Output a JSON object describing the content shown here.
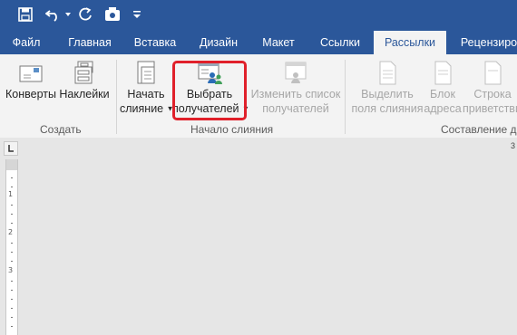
{
  "tabs": [
    "Файл",
    "Главная",
    "Вставка",
    "Дизайн",
    "Макет",
    "Ссылки",
    "Рассылки",
    "Рецензиро"
  ],
  "ribbon": {
    "create": {
      "envelopes": "Конверты",
      "labels": "Наклейки",
      "group_label": "Создать"
    },
    "start_merge": {
      "start_line1": "Начать",
      "start_line2": "слияние",
      "select_line1": "Выбрать",
      "select_line2": "получателей",
      "edit_line1": "Изменить список",
      "edit_line2": "получателей",
      "group_label": "Начало слияния"
    },
    "compose": {
      "highlight_line1": "Выделить",
      "highlight_line2": "поля слияния",
      "address_line1": "Блок",
      "address_line2": "адреса",
      "greeting_line1": "Строка",
      "greeting_line2": "приветствия",
      "group_label": "Составление до"
    }
  },
  "ruler": {
    "numbers": [
      "1",
      "2",
      "3"
    ],
    "right_edge": "3"
  },
  "colors": {
    "title_bar": "#2b579a",
    "highlight_border": "#e0202a"
  },
  "icons": [
    "save-icon",
    "undo-icon",
    "redo-icon",
    "touch-mode-icon",
    "customize-qat-icon"
  ]
}
